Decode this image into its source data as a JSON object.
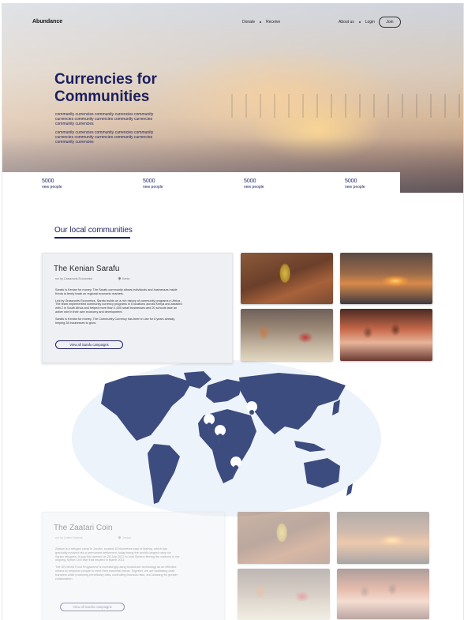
{
  "header": {
    "logo": "Abundance",
    "nav_left": [
      "Donate",
      "Receive"
    ],
    "nav_right": [
      "About us",
      "Login"
    ],
    "join_label": "Join"
  },
  "hero": {
    "title": "Currencies for Communities",
    "subtitle_block_1": "community currencies community currencies community currencies community currencies community currencies community currencies",
    "subtitle_block_2": "community currencies community currencies community currencies community currencies community currencies community currencies"
  },
  "stats": [
    {
      "value": "5000",
      "label": "new people"
    },
    {
      "value": "5000",
      "label": "new people"
    },
    {
      "value": "5000",
      "label": "new people"
    },
    {
      "value": "5000",
      "label": "new people"
    }
  ],
  "section": {
    "title": "Our local communities"
  },
  "communities": [
    {
      "name": "The Kenian Sarafu",
      "run_by": "run by Grassroots Economics",
      "location": "Kenia",
      "paragraphs": [
        "Sarafu is Kenian for money. The Sarafu community allows individuals and businesses inside Kenia to freely trade on regional economic markets.",
        "Led by Grassroots Economics, Sarafu builds on a rich history of community programs in Africa - The team implemented community currency programs in 6 locations across Kenya and assisted with 2 in South Africa and helped more than 1,000 small businesses and 20 schools take an active role in their own economy and development.",
        "Sarafu is Kenian for money. The Community Currency has been in use for 8 years already, helping 28 businesses to grow."
      ],
      "button_label": "View all Sarafu campaigns"
    },
    {
      "name": "The Zaatari Coin",
      "run_by": "run by United Nations",
      "location": "Jordan",
      "paragraphs": [
        "Zaatari is a refugee camp in Jordan, located 10 kilometres east of Mafraq, which has gradually evolved into a permanent settlement; today being the world's largest camp for Syrian refugees. It was first opened on 28 July 2012 to host Syrians fleeing the violence in the ongoing Syrian Civil War that erupted in March 2011.",
        "The UN World Food Programme is increasingly using blockchain technology as an effective means to empower people to meet their essential needs. Together, we are facilitating cash transfers while protecting beneficiary data, controlling financial risks, and allowing for greater collaboration."
      ],
      "button_label": "View all Sarafu campaigns"
    }
  ],
  "photos": [
    "shovel-photo",
    "market-photo",
    "women-photo",
    "children-photo"
  ],
  "map": {
    "land_color": "#3d4c7f",
    "background_color": "#edf3fa",
    "pins": [
      "map-pin-icon",
      "map-pin-icon",
      "map-pin-icon",
      "map-pin-icon",
      "map-pin-icon"
    ]
  },
  "colors": {
    "navy": "#1b1f5e",
    "card_bg": "#eef0f4"
  }
}
